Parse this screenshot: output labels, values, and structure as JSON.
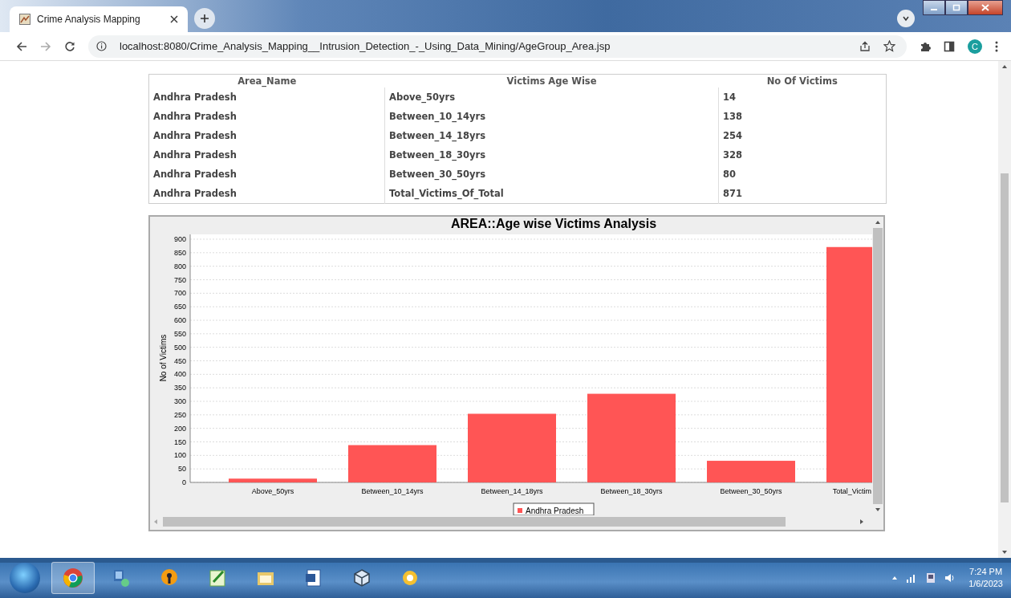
{
  "browser": {
    "tab_title": "Crime Analysis Mapping",
    "url": "localhost:8080/Crime_Analysis_Mapping__Intrusion_Detection_-_Using_Data_Mining/AgeGroup_Area.jsp",
    "profile_initial": "C"
  },
  "table": {
    "columns": [
      "Area_Name",
      "Victims Age Wise",
      "No Of Victims"
    ],
    "rows": [
      [
        "Andhra Pradesh",
        "Above_50yrs",
        "14"
      ],
      [
        "Andhra Pradesh",
        "Between_10_14yrs",
        "138"
      ],
      [
        "Andhra Pradesh",
        "Between_14_18yrs",
        "254"
      ],
      [
        "Andhra Pradesh",
        "Between_18_30yrs",
        "328"
      ],
      [
        "Andhra Pradesh",
        "Between_30_50yrs",
        "80"
      ],
      [
        "Andhra Pradesh",
        "Total_Victims_Of_Total",
        "871"
      ]
    ]
  },
  "chart": {
    "chart_data": {
      "type": "bar",
      "title": "AREA::Age wise Victims Analysis",
      "ylabel": "No of Victims",
      "categories": [
        "Above_50yrs",
        "Between_10_14yrs",
        "Between_14_18yrs",
        "Between_18_30yrs",
        "Between_30_50yrs",
        "Total_Victim"
      ],
      "series": [
        {
          "name": "Andhra Pradesh",
          "color": "#ff5555",
          "values": [
            14,
            138,
            254,
            328,
            80,
            871
          ]
        }
      ],
      "ylim": [
        0,
        900
      ],
      "grid": true,
      "yticks": [
        0,
        50,
        100,
        150,
        200,
        250,
        300,
        350,
        400,
        450,
        500,
        550,
        600,
        650,
        700,
        750,
        800,
        850,
        900
      ]
    }
  },
  "taskbar": {
    "time": "7:24 PM",
    "date": "1/6/2023"
  }
}
